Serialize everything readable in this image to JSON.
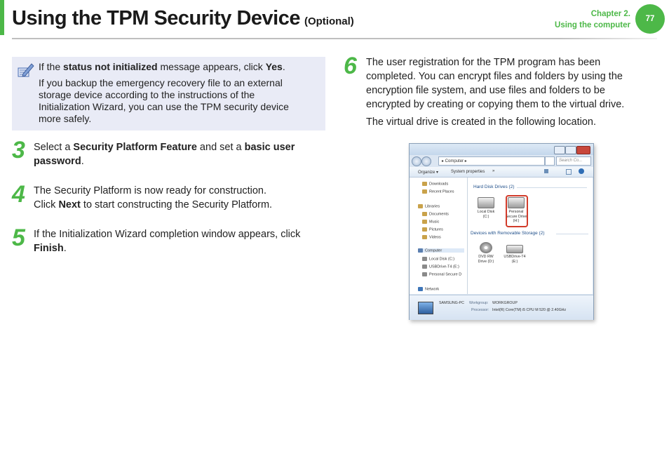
{
  "header": {
    "title": "Using the TPM Security Device",
    "title_suffix": "(Optional)",
    "chapter_line1": "Chapter 2.",
    "chapter_line2": "Using the computer",
    "page_number": "77",
    "accent_color": "#4db848"
  },
  "note": {
    "icon": "pencil-note-icon",
    "line1_pre": "If the ",
    "line1_bold": "status not initialized",
    "line1_mid": " message appears, click ",
    "line1_bold2": "Yes",
    "line1_end": ".",
    "line2": "If you backup the emergency recovery file to an external storage device according to the instructions of the Initialization Wizard, you can use the TPM security device more safely."
  },
  "steps": [
    {
      "number": "3",
      "pre": "Select a ",
      "bold1": "Security Platform Feature",
      "mid": " and set a ",
      "bold2": "basic user password",
      "end": "."
    },
    {
      "number": "4",
      "line1": "The Security Platform is now ready for construction.",
      "pre": "Click ",
      "bold1": "Next",
      "end": " to start constructing the Security Platform."
    },
    {
      "number": "5",
      "pre": "If the Initialization Wizard completion window appears, click ",
      "bold1": "Finish",
      "end": "."
    },
    {
      "number": "6",
      "para1": "The user registration for the TPM program has been completed. You can encrypt files and folders by using the encryption file system, and use files and folders to be encrypted by creating or copying them to the virtual drive.",
      "para2": "The virtual drive is created in the following location."
    }
  ],
  "screenshot": {
    "address": "▸ Computer ▸",
    "search_placeholder": "Search Co...",
    "toolbar_organize": "Organize ▾",
    "toolbar_system": "System properties",
    "toolbar_more": "»",
    "nav_items": [
      "Downloads",
      "Recent Places",
      "Libraries",
      "Documents",
      "Music",
      "Pictures",
      "Videos",
      "Computer",
      "Local Disk (C:)",
      "USBDrive-T4 (E:)",
      "Personal Secure D",
      "Network"
    ],
    "section_hdd": "Hard Disk Drives (2)",
    "section_removable": "Devices with Removable Storage (2)",
    "drive_c": "Local Disk (C:)",
    "drive_secure": "Personal Secure Drive (H:)",
    "drive_dvd": "DVD RW Drive (D:)",
    "drive_usb": "USBDrive-T4 (E:)",
    "details_pc": "SAMSUNG-PC",
    "details_workgroup_label": "Workgroup:",
    "details_workgroup": "WORKGROUP",
    "details_processor_label": "Processor:",
    "details_processor": "Intel(R) Core(TM) i5 CPU     M 520  @ 2.40GHz"
  }
}
